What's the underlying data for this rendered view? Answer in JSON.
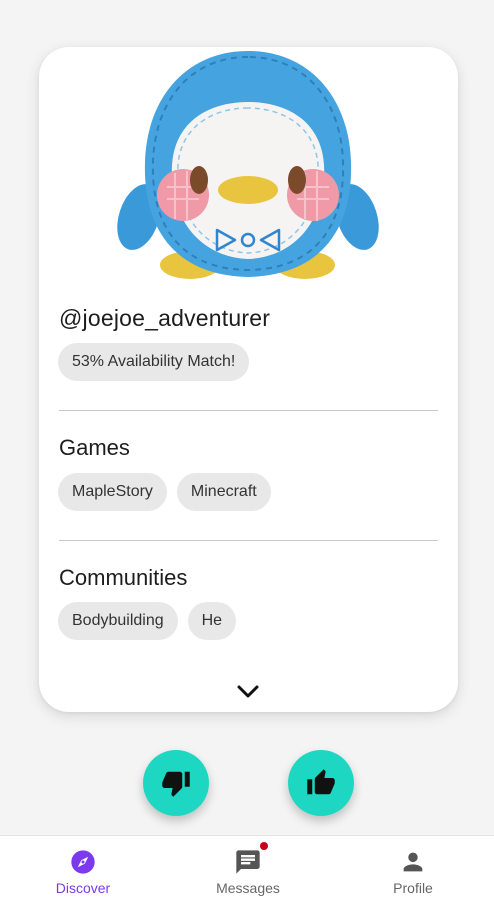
{
  "profile": {
    "username": "@joejoe_adventurer",
    "availability_match": "53% Availability Match!"
  },
  "sections": {
    "games": {
      "title": "Games",
      "items": [
        "MapleStory",
        "Minecraft"
      ]
    },
    "communities": {
      "title": "Communities",
      "items": [
        "Bodybuilding",
        "He"
      ]
    }
  },
  "actions": {
    "dislike_icon": "thumb-down-icon",
    "like_icon": "thumb-up-icon"
  },
  "nav": {
    "items": [
      {
        "label": "Discover",
        "icon": "compass-icon",
        "active": true
      },
      {
        "label": "Messages",
        "icon": "message-icon",
        "active": false,
        "has_badge": true
      },
      {
        "label": "Profile",
        "icon": "person-icon",
        "active": false
      }
    ]
  },
  "colors": {
    "accent": "#7c3aed",
    "fab": "#1ed7c3",
    "badge": "#c4001a",
    "chip": "#e8e8e8"
  }
}
